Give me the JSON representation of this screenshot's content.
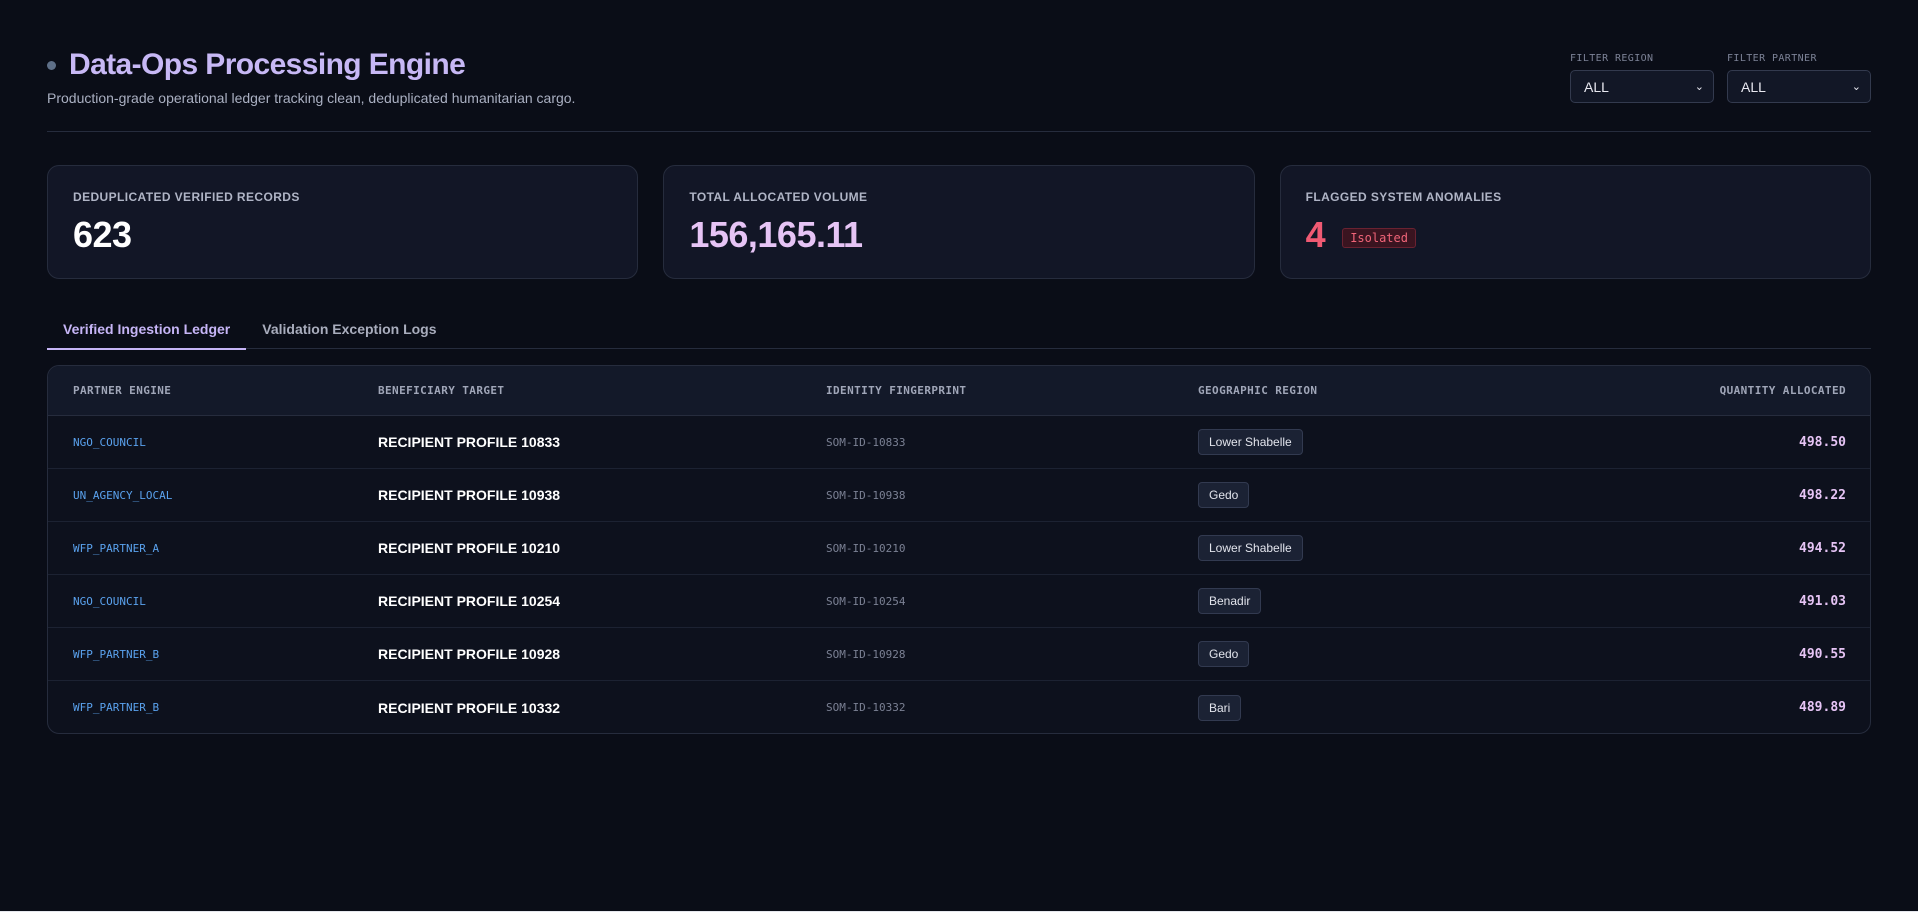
{
  "header": {
    "title": "Data-Ops Processing Engine",
    "subtitle": "Production-grade operational ledger tracking clean, deduplicated humanitarian cargo."
  },
  "filters": {
    "region": {
      "label": "FILTER REGION",
      "value": "ALL"
    },
    "partner": {
      "label": "FILTER PARTNER",
      "value": "ALL"
    }
  },
  "cards": {
    "records": {
      "label": "DEDUPLICATED VERIFIED RECORDS",
      "value": "623"
    },
    "volume": {
      "label": "TOTAL ALLOCATED VOLUME",
      "value": "156,165.11"
    },
    "anomalies": {
      "label": "FLAGGED SYSTEM ANOMALIES",
      "value": "4",
      "badge": "Isolated"
    }
  },
  "tabs": [
    {
      "label": "Verified Ingestion Ledger",
      "active": true
    },
    {
      "label": "Validation Exception Logs",
      "active": false
    }
  ],
  "table": {
    "columns": [
      "PARTNER ENGINE",
      "BENEFICIARY TARGET",
      "IDENTITY FINGERPRINT",
      "GEOGRAPHIC REGION",
      "QUANTITY ALLOCATED"
    ],
    "rows": [
      {
        "partner": "NGO_COUNCIL",
        "recipient": "RECIPIENT PROFILE 10833",
        "fingerprint": "SOM-ID-10833",
        "region": "Lower Shabelle",
        "quantity": "498.50"
      },
      {
        "partner": "UN_AGENCY_LOCAL",
        "recipient": "RECIPIENT PROFILE 10938",
        "fingerprint": "SOM-ID-10938",
        "region": "Gedo",
        "quantity": "498.22"
      },
      {
        "partner": "WFP_PARTNER_A",
        "recipient": "RECIPIENT PROFILE 10210",
        "fingerprint": "SOM-ID-10210",
        "region": "Lower Shabelle",
        "quantity": "494.52"
      },
      {
        "partner": "NGO_COUNCIL",
        "recipient": "RECIPIENT PROFILE 10254",
        "fingerprint": "SOM-ID-10254",
        "region": "Benadir",
        "quantity": "491.03"
      },
      {
        "partner": "WFP_PARTNER_B",
        "recipient": "RECIPIENT PROFILE 10928",
        "fingerprint": "SOM-ID-10928",
        "region": "Gedo",
        "quantity": "490.55"
      },
      {
        "partner": "WFP_PARTNER_B",
        "recipient": "RECIPIENT PROFILE 10332",
        "fingerprint": "SOM-ID-10332",
        "region": "Bari",
        "quantity": "489.89"
      }
    ]
  },
  "icons": {
    "status": "status-dot-icon",
    "dropdown": "chevron-down-icon"
  },
  "colors": {
    "accent": "#c6b5f6",
    "danger": "#f05a73",
    "link": "#5aa2ee",
    "background": "#0a0d17"
  }
}
